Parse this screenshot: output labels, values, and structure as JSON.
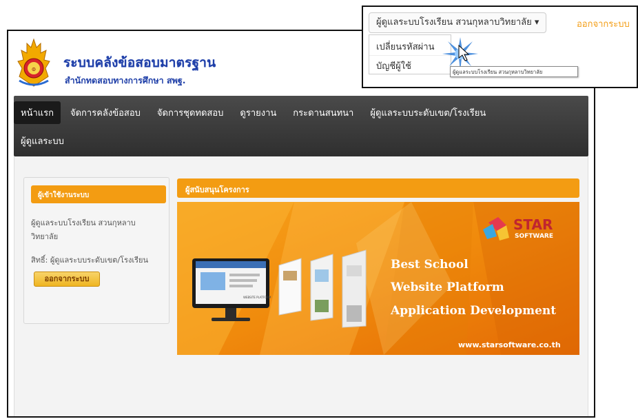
{
  "site": {
    "title": "ระบบคลังข้อสอบมาตรฐาน",
    "subtitle": "สำนักทดสอบทางการศึกษา สพฐ."
  },
  "navbar": {
    "items": [
      {
        "label": "หน้าแรก",
        "active": true
      },
      {
        "label": "จัดการคลังข้อสอบ"
      },
      {
        "label": "จัดการชุดทดสอบ"
      },
      {
        "label": "ดูรายงาน"
      },
      {
        "label": "กระดานสนทนา"
      },
      {
        "label": "ผู้ดูแลระบบระดับเขต/โรงเรียน"
      },
      {
        "label": "ผู้ดูแลระบบ"
      }
    ]
  },
  "login_panel": {
    "heading": "ผู้เข้าใช้งานระบบ",
    "user_line1": "ผู้ดูแลระบบโรงเรียน สวนกุหลาบ",
    "user_line2": "วิทยาลัย",
    "role": "สิทธิ์: ผู้ดูแลระบบระดับเขต/โรงเรียน",
    "logout_label": "ออกจากระบบ"
  },
  "sponsor": {
    "heading": "ผู้สนับสนุนโครงการ",
    "brand_star": "STAR",
    "brand_software": "SOFTWARE",
    "line1": "Best School",
    "line2": "Website Platform",
    "line3": "Application Development",
    "url": "www.starsoftware.co.th",
    "screen_text": "WEBSITE PLATFORM"
  },
  "popup": {
    "dropdown_label": "ผู้ดูแลระบบโรงเรียน สวนกุหลาบวิทยาลัย ▾",
    "logout_link": "ออกจากระบบ",
    "menu": [
      "เปลี่ยนรหัสผ่าน",
      "บัญชีผู้ใช้"
    ],
    "tooltip": "ผู้ดูแลระบบโรงเรียน สวนกุหลาบวิทยาลัย"
  },
  "colors": {
    "accent": "#f39c12",
    "title_blue": "#1f3fa8",
    "navbar": "#3a3a3a"
  }
}
